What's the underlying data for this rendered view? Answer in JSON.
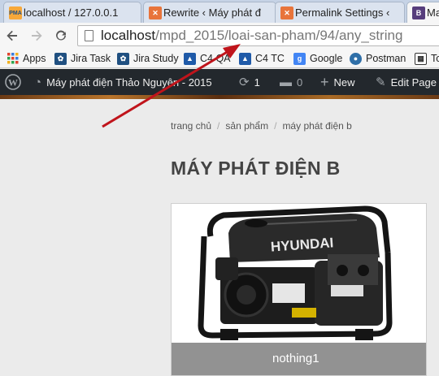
{
  "browser": {
    "tabs": [
      {
        "label": "localhost / 127.0.0.1",
        "favicon_text": "PMA",
        "favicon_color": "#f7a83a"
      },
      {
        "label": "Rewrite ‹ Máy phát đ",
        "favicon_text": "",
        "favicon_color": "#e8743b"
      },
      {
        "label": "Permalink Settings ‹",
        "favicon_text": "",
        "favicon_color": "#e8743b"
      },
      {
        "label": "Ma",
        "favicon_text": "B",
        "favicon_color": "#563d7c"
      }
    ],
    "close_glyph": "×",
    "url_host": "localhost",
    "url_path": "/mpd_2015/loai-san-pham/94/any_string"
  },
  "bookmarks": [
    {
      "label": "Apps",
      "icon": "apps-grid-icon",
      "color": "#e0442e"
    },
    {
      "label": "Jira Task",
      "icon": "jira-icon",
      "color": "#205081"
    },
    {
      "label": "Jira Study",
      "icon": "jira-icon",
      "color": "#205081"
    },
    {
      "label": "C4 QA",
      "icon": "c4-icon",
      "color": "#1f5aa8"
    },
    {
      "label": "C4 TC",
      "icon": "c4-icon",
      "color": "#1f5aa8"
    },
    {
      "label": "Google",
      "icon": "google-icon",
      "color": "#4285f4"
    },
    {
      "label": "Postman",
      "icon": "postman-icon",
      "color": "#2f6fa8"
    },
    {
      "label": "To",
      "icon": "table-icon",
      "color": "#333333"
    }
  ],
  "adminbar": {
    "site_name": "Máy phát điện Thảo Nguyên - 2015",
    "updates_count": "1",
    "comments_count": "0",
    "new_label": "New",
    "edit_label": "Edit Page"
  },
  "page": {
    "breadcrumb": [
      "trang chủ",
      "sản phẩm",
      "máy phát điện b"
    ],
    "breadcrumb_sep": "/",
    "title": "MÁY PHÁT ĐIỆN B",
    "product_caption": "nothing1",
    "brand_text": "HYUNDAI"
  }
}
